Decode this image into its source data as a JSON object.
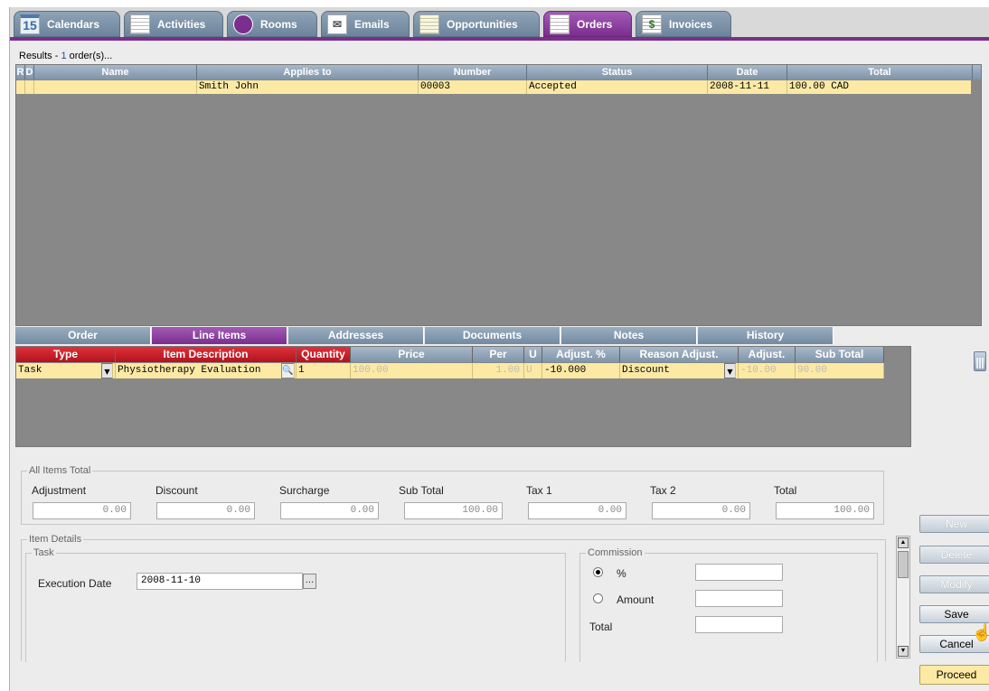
{
  "tabs": [
    {
      "label": "Calendars",
      "icon": "calendar-icon",
      "glyph": "15"
    },
    {
      "label": "Activities",
      "icon": "activities-icon",
      "glyph": ""
    },
    {
      "label": "Rooms",
      "icon": "rooms-icon",
      "glyph": ""
    },
    {
      "label": "Emails",
      "icon": "email-icon",
      "glyph": "✉"
    },
    {
      "label": "Opportunities",
      "icon": "opportunities-icon",
      "glyph": ""
    },
    {
      "label": "Orders",
      "icon": "orders-icon",
      "glyph": ""
    },
    {
      "label": "Invoices",
      "icon": "invoices-icon",
      "glyph": "$"
    }
  ],
  "results": {
    "prefix": "Results -",
    "count": "1",
    "suffix": "order(s)..."
  },
  "orders_table": {
    "columns": [
      "R",
      "D",
      "Name",
      "Applies to",
      "Number",
      "Status",
      "Date",
      "Total"
    ],
    "rows": [
      {
        "r": "",
        "d": "",
        "name": "",
        "applies_to": "Smith John",
        "number": "00003",
        "status": "Accepted",
        "date": "2008-11-11",
        "total": "100.00 CAD"
      }
    ]
  },
  "detail_tabs": [
    "Order",
    "Line Items",
    "Addresses",
    "Documents",
    "Notes",
    "History"
  ],
  "line_items": {
    "columns": [
      "Type",
      "Item Description",
      "Quantity",
      "Price",
      "Per",
      "U",
      "Adjust. %",
      "Reason Adjust.",
      "Adjust.",
      "Sub Total"
    ],
    "rows": [
      {
        "type": "Task",
        "description": "Physiotherapy Evaluation",
        "quantity": "1",
        "price": "100.00",
        "per": "1.00",
        "u": "U",
        "adjust_pct": "-10.000",
        "reason": "Discount",
        "adjust": "-10.00",
        "subtotal": "90.00"
      }
    ]
  },
  "all_items_total": {
    "legend": "All Items Total",
    "fields": [
      {
        "label": "Adjustment",
        "value": "0.00"
      },
      {
        "label": "Discount",
        "value": "0.00"
      },
      {
        "label": "Surcharge",
        "value": "0.00"
      },
      {
        "label": "Sub Total",
        "value": "100.00"
      },
      {
        "label": "Tax 1",
        "value": "0.00"
      },
      {
        "label": "Tax 2",
        "value": "0.00"
      },
      {
        "label": "Total",
        "value": "100.00"
      }
    ]
  },
  "item_details": {
    "legend": "Item Details",
    "task_legend": "Task",
    "execution_date_label": "Execution Date",
    "execution_date": "2008-11-10",
    "commission": {
      "legend": "Commission",
      "percent_label": "%",
      "amount_label": "Amount",
      "total_label": "Total",
      "selected": "percent"
    }
  },
  "buttons": {
    "new": "New",
    "delete": "Delete",
    "modify": "Modify",
    "save": "Save",
    "cancel": "Cancel",
    "proceed": "Proceed"
  }
}
